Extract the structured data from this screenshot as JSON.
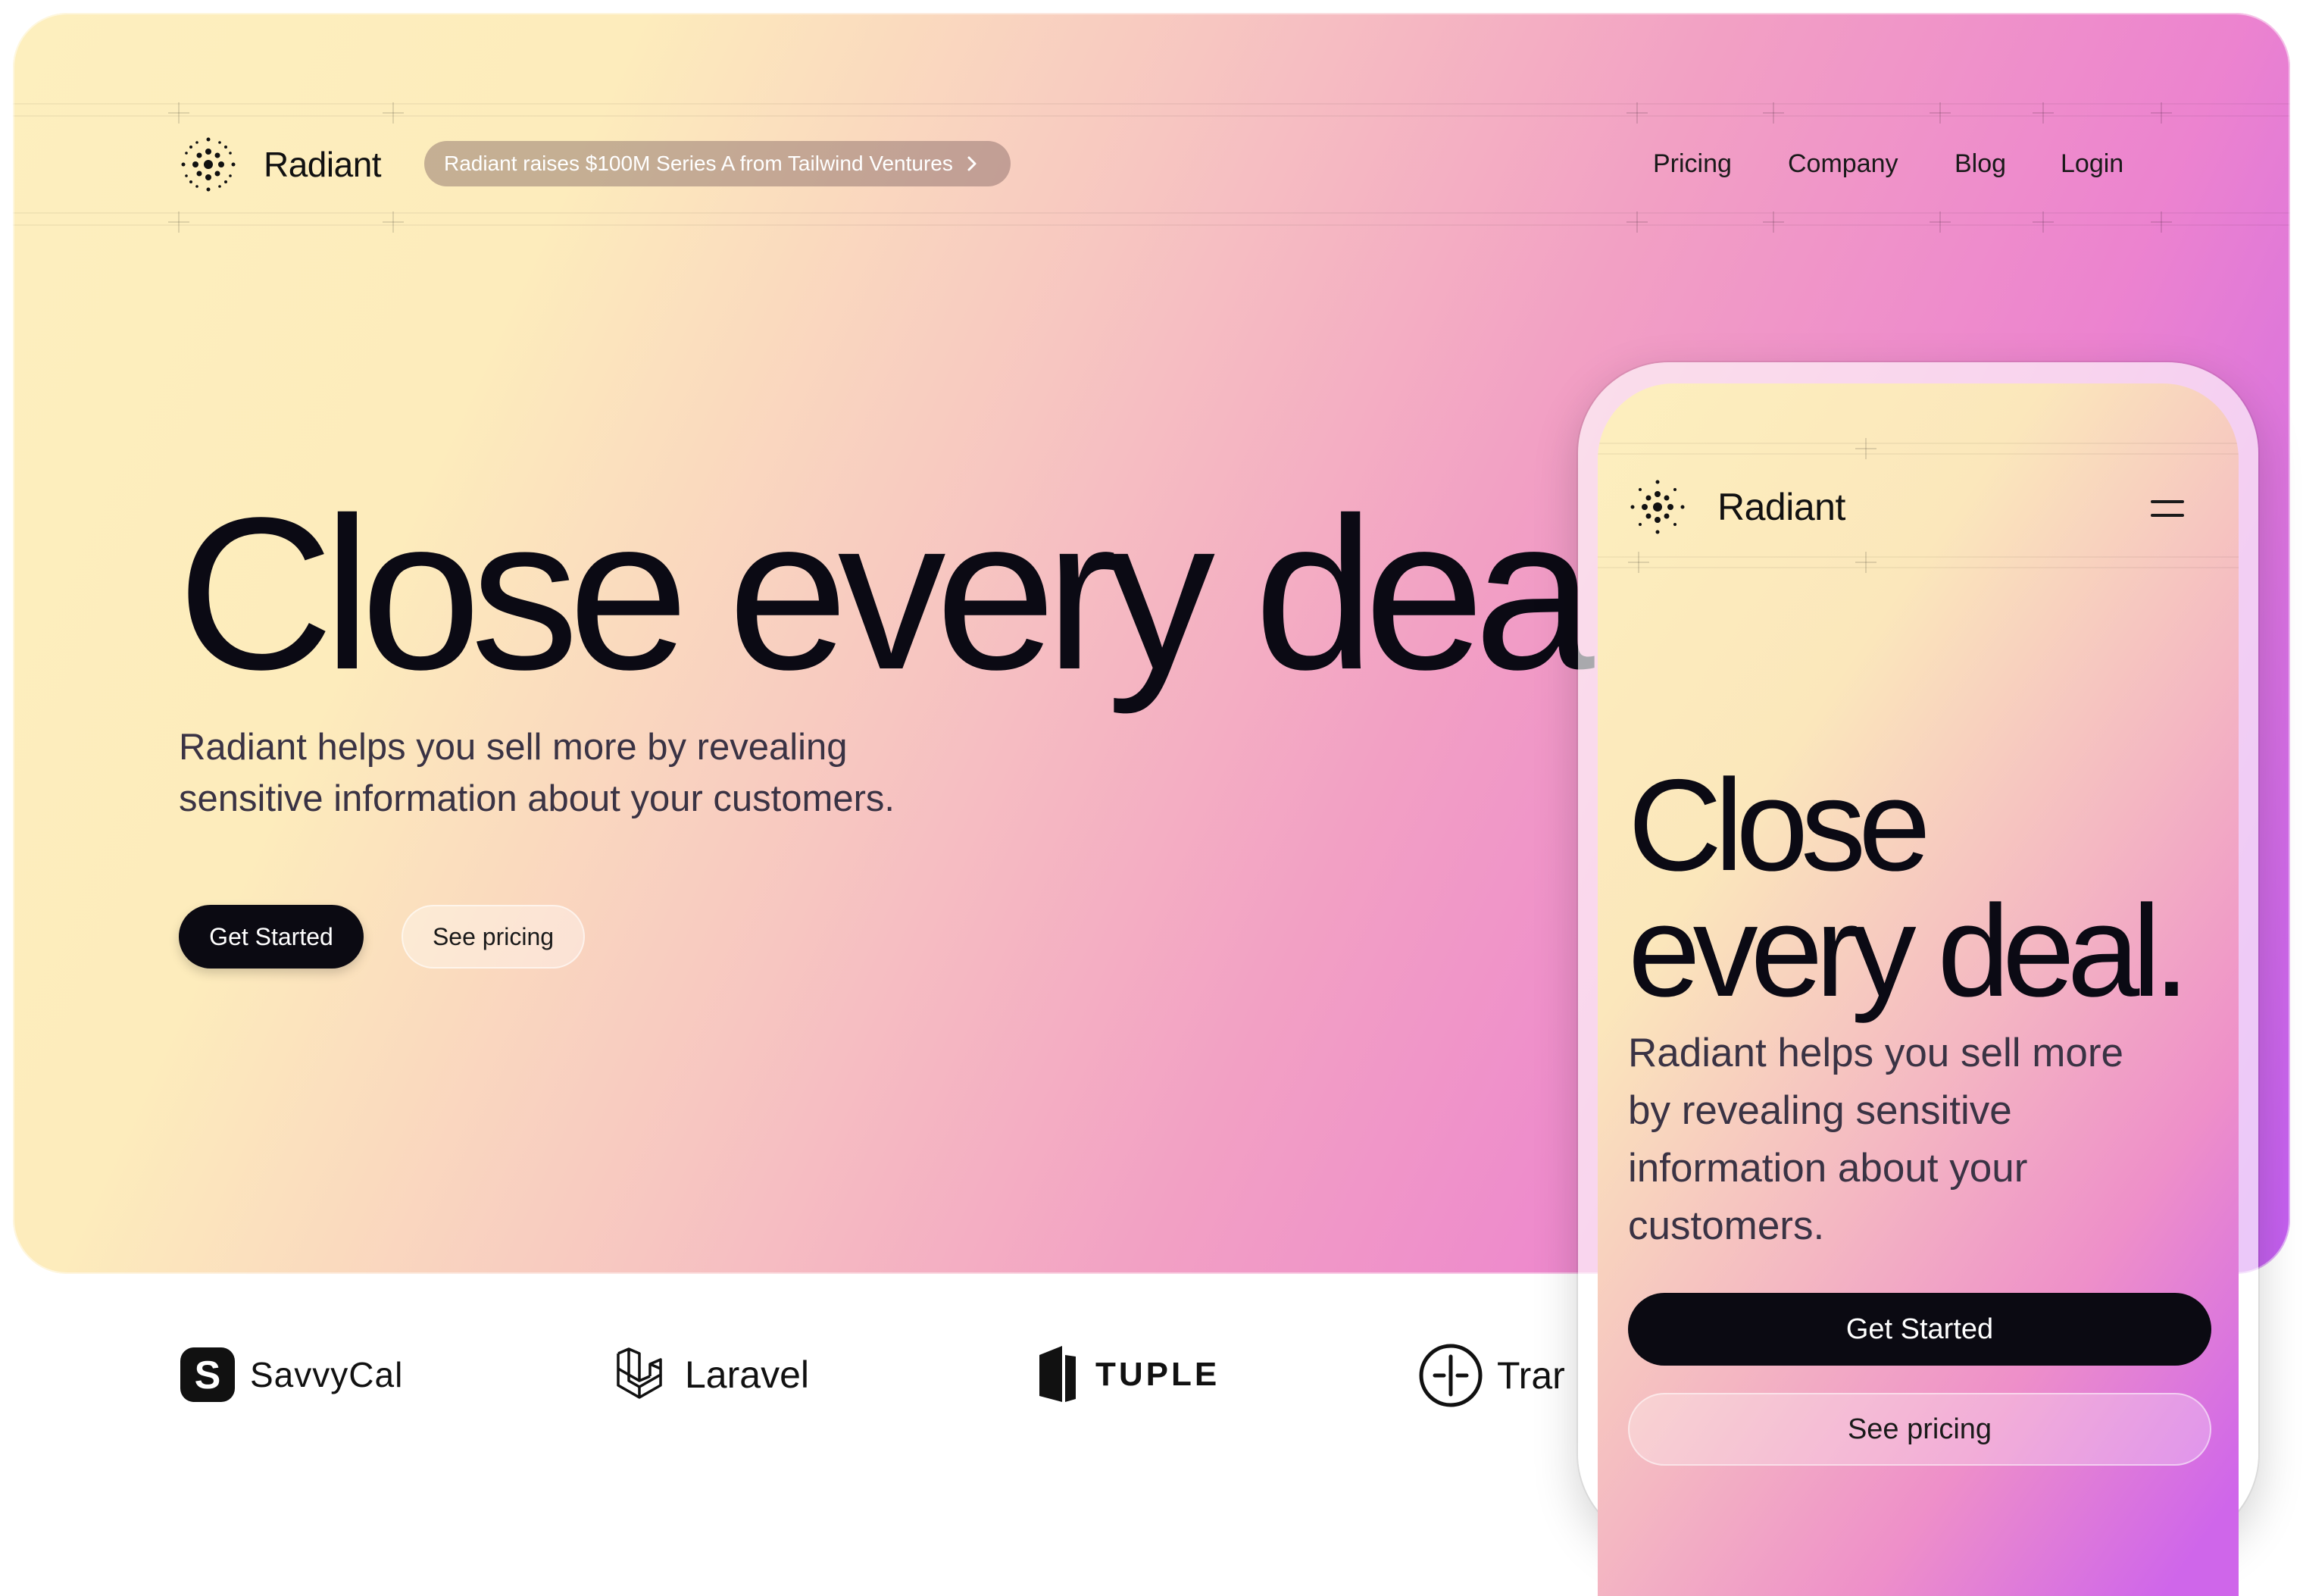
{
  "colors": {
    "brand_dark": "#0b0a12",
    "gradient_start": "#fdefbe",
    "gradient_mid": "#ec83cf",
    "gradient_end": "#c25ef0"
  },
  "header": {
    "logo_icon": "radiant-dots-icon",
    "brand_name": "Radiant",
    "announcement": "Radiant raises $100M Series A from Tailwind Ventures",
    "announcement_icon": "chevron-right-icon",
    "nav": [
      "Pricing",
      "Company",
      "Blog",
      "Login"
    ]
  },
  "hero": {
    "headline": "Close every deal.",
    "subhead_line1": "Radiant helps you sell more by revealing",
    "subhead_line2": "sensitive information about your customers.",
    "primary_cta": "Get Started",
    "secondary_cta": "See pricing"
  },
  "brands": [
    {
      "name": "SavvyCal",
      "icon": "savvycal-logo-icon"
    },
    {
      "name": "Laravel",
      "icon": "laravel-logo-icon"
    },
    {
      "name": "TUPLE",
      "icon": "tuple-logo-icon"
    },
    {
      "name": "Trar",
      "icon": "transistor-logo-icon"
    }
  ],
  "mobile": {
    "brand_name": "Radiant",
    "menu_icon": "hamburger-menu-icon",
    "headline_line1": "Close",
    "headline_line2": "every deal.",
    "subhead_lines": [
      "Radiant helps you sell more",
      "by revealing sensitive",
      "information about your",
      "customers."
    ],
    "primary_cta": "Get Started",
    "secondary_cta": "See pricing"
  }
}
